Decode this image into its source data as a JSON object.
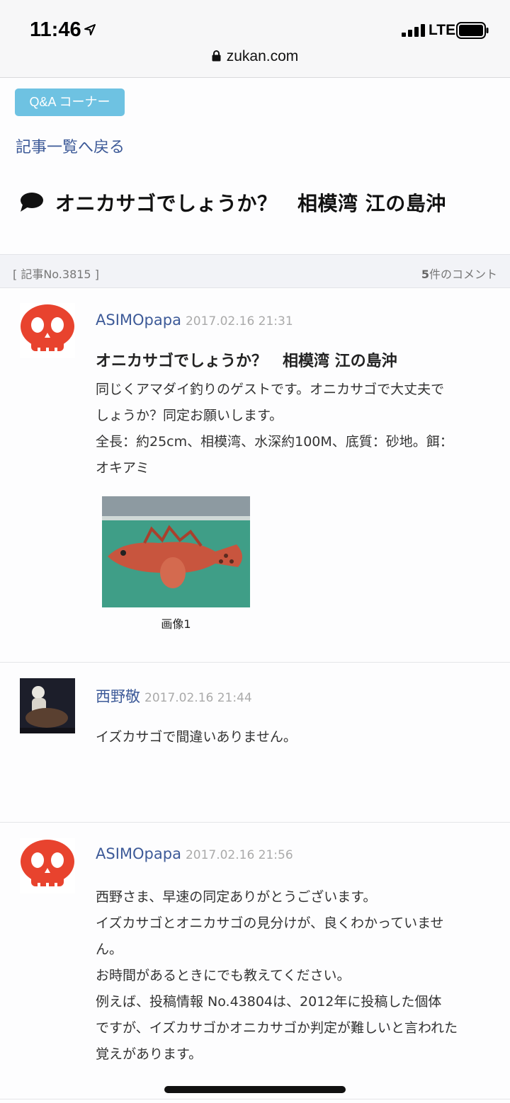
{
  "status_bar": {
    "time": "11:46",
    "carrier": "LTE",
    "location_icon": "location-arrow-icon",
    "signal_icon": "signal-bars-icon",
    "battery_icon": "battery-icon"
  },
  "browser": {
    "url": "zukan.com",
    "lock_icon": "lock-icon"
  },
  "header": {
    "badge": "Q&A コーナー",
    "back_link": "記事一覧へ戻る",
    "title": "オニカサゴでしょうか？　相模湾 江の島沖",
    "title_icon": "speech-bubble-icon"
  },
  "meta": {
    "article_no": "[ 記事No.3815 ]",
    "comment_count": "5",
    "comment_suffix": "件のコメント"
  },
  "posts": [
    {
      "author": "ASIMOpapa",
      "date": "2017.02.16 21:31",
      "title": "オニカサゴでしょうか？　相模湾 江の島沖",
      "body_lines": [
        "同じくアマダイ釣りのゲストです。オニカサゴで大丈夫で",
        "しょうか？同定お願いします。",
        "全長：約25cm、相模湾、水深約100M、底質：砂地。餌：",
        "オキアミ"
      ],
      "image_caption": "画像1"
    },
    {
      "author": "西野敬",
      "date": "2017.02.16 21:44",
      "body_lines": [
        "イズカサゴで間違いありません。"
      ]
    },
    {
      "author": "ASIMOpapa",
      "date": "2017.02.16 21:56",
      "body_lines": [
        "西野さま、早速の同定ありがとうございます。",
        "イズカサゴとオニカサゴの見分けが、良くわかっていませ",
        "ん。",
        "お時間があるときにでも教えてください。",
        "例えば、投稿情報 No.43804は、2012年に投稿した個体",
        "ですが、イズカサゴかオニカサゴか判定が難しいと言われた",
        "覚えがあります。"
      ]
    }
  ],
  "colors": {
    "badge": "#6ec2e2",
    "link": "#3d5a98",
    "avatar_skull": "#e8432e"
  }
}
